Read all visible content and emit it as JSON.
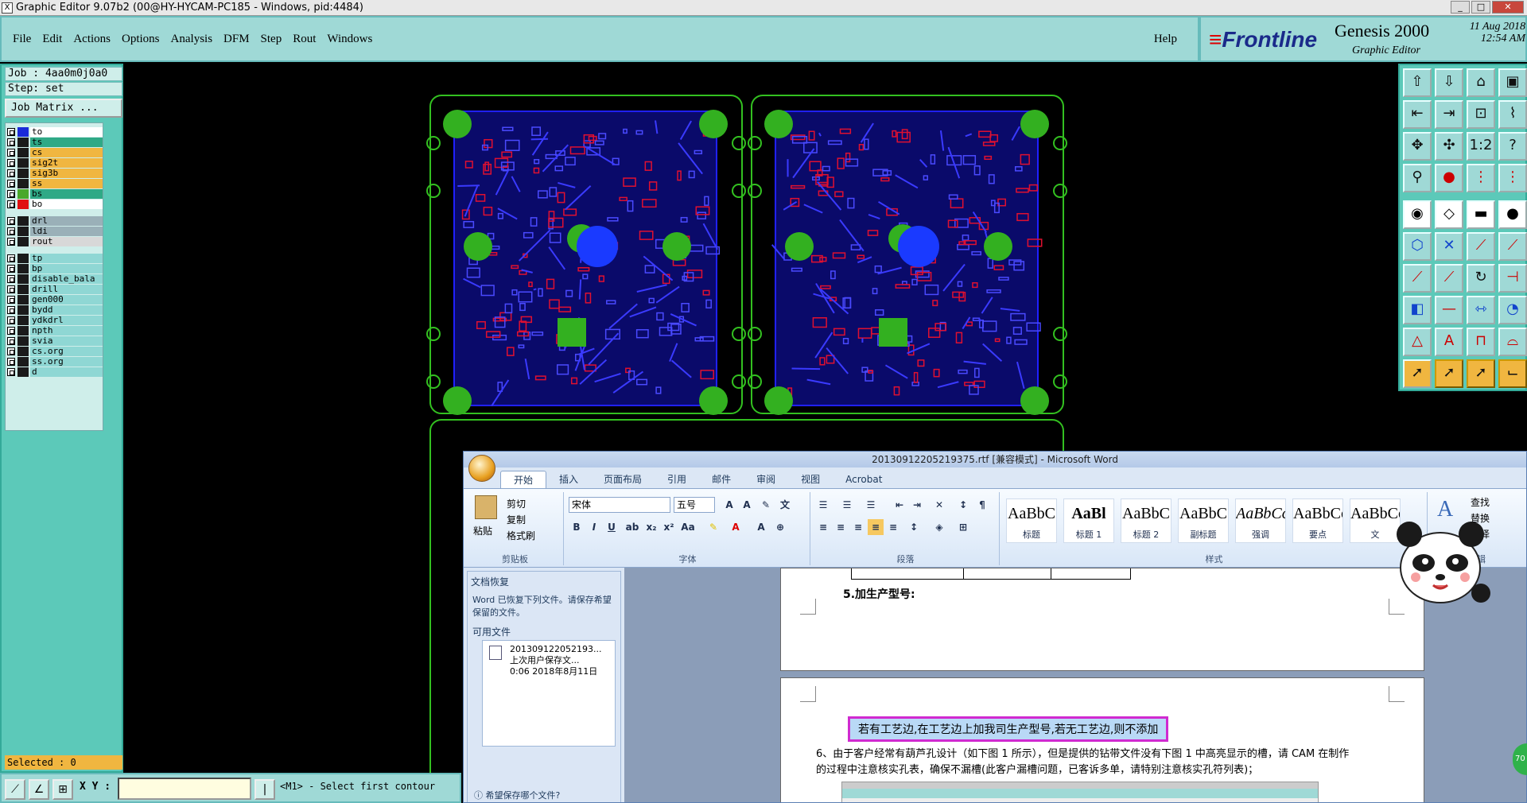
{
  "window": {
    "title": "Graphic Editor 9.07b2 (00@HY-HYCAM-PC185 - Windows, pid:4484)",
    "icon": "x-icon"
  },
  "menu": {
    "items": [
      "File",
      "Edit",
      "Actions",
      "Options",
      "Analysis",
      "DFM",
      "Step",
      "Rout",
      "Windows"
    ],
    "help": "Help"
  },
  "logo": {
    "brand": "Frontline",
    "product": "Genesis 2000",
    "subtitle": "Graphic Editor",
    "date": "11 Aug 2018",
    "time": "12:54 AM"
  },
  "job": {
    "job_line": "Job : 4aa0m0j0a0",
    "step_line": "Step: set",
    "matrix_button": "Job Matrix ..."
  },
  "layers": [
    {
      "name": "to",
      "color": "#1a2ad8",
      "bg": "#ffffff"
    },
    {
      "name": "ts",
      "color": "#1a1a1a",
      "bg": "#2fa986"
    },
    {
      "name": "cs",
      "color": "#1a1a1a",
      "bg": "#f0b640"
    },
    {
      "name": "sig2t",
      "color": "#1a1a1a",
      "bg": "#f0b640"
    },
    {
      "name": "sig3b",
      "color": "#1a1a1a",
      "bg": "#f0b640"
    },
    {
      "name": "ss",
      "color": "#1a1a1a",
      "bg": "#f0b640"
    },
    {
      "name": "bs",
      "color": "#4aa82a",
      "bg": "#2fa986"
    },
    {
      "name": "bo",
      "color": "#e01010",
      "bg": "#ffffff"
    },
    {
      "name": "drl",
      "color": "#1a1a1a",
      "bg": "#9ab0b8"
    },
    {
      "name": "ldi",
      "color": "#1a1a1a",
      "bg": "#9ab0b8"
    },
    {
      "name": "rout",
      "color": "#1a1a1a",
      "bg": "#d8d8d8"
    },
    {
      "name": "tp",
      "color": "#1a1a1a",
      "bg": "#8fd7d4"
    },
    {
      "name": "bp",
      "color": "#1a1a1a",
      "bg": "#8fd7d4"
    },
    {
      "name": "disable_bala",
      "color": "#1a1a1a",
      "bg": "#8fd7d4"
    },
    {
      "name": "drill",
      "color": "#1a1a1a",
      "bg": "#8fd7d4"
    },
    {
      "name": "gen000",
      "color": "#1a1a1a",
      "bg": "#8fd7d4"
    },
    {
      "name": "bydd",
      "color": "#1a1a1a",
      "bg": "#8fd7d4"
    },
    {
      "name": "ydkdrl",
      "color": "#1a1a1a",
      "bg": "#8fd7d4"
    },
    {
      "name": "npth",
      "color": "#1a1a1a",
      "bg": "#8fd7d4"
    },
    {
      "name": "svia",
      "color": "#1a1a1a",
      "bg": "#8fd7d4"
    },
    {
      "name": "cs.org",
      "color": "#1a1a1a",
      "bg": "#8fd7d4"
    },
    {
      "name": "ss.org",
      "color": "#1a1a1a",
      "bg": "#8fd7d4"
    },
    {
      "name": "d",
      "color": "#1a1a1a",
      "bg": "#8fd7d4"
    }
  ],
  "status": {
    "selected": "Selected : 0",
    "xy_label": "X Y :",
    "prompt": "<M1> - Select first contour"
  },
  "word": {
    "title": "20130912205219375.rtf [兼容模式] - Microsoft Word",
    "tabs": [
      "开始",
      "插入",
      "页面布局",
      "引用",
      "邮件",
      "审阅",
      "视图",
      "Acrobat"
    ],
    "clipboard": {
      "paste": "粘贴",
      "cut": "剪切",
      "copy": "复制",
      "format": "格式刷",
      "group": "剪贴板"
    },
    "font": {
      "name": "宋体",
      "size": "五号",
      "group": "字体"
    },
    "paragraph_group": "段落",
    "styles_group": "样式",
    "styles": [
      {
        "preview": "AaBbC",
        "label": "标题"
      },
      {
        "preview": "AaBl",
        "label": "标题 1"
      },
      {
        "preview": "AaBbC",
        "label": "标题 2"
      },
      {
        "preview": "AaBbC",
        "label": "副标题"
      },
      {
        "preview": "AaBbCcD",
        "label": "强调"
      },
      {
        "preview": "AaBbCcD",
        "label": "要点"
      },
      {
        "preview": "AaBbCcD",
        "label": "文"
      }
    ],
    "editing": {
      "find": "查找",
      "replace": "替换",
      "select": "选择",
      "group": "编辑"
    },
    "recovery": {
      "title": "文档恢复",
      "desc": "Word 已恢复下列文件。请保存希望保留的文件。",
      "available": "可用文件",
      "file_name": "201309122052193...",
      "file_note": "上次用户保存文...",
      "file_time": "0:06 2018年8月11日",
      "link": "希望保存哪个文件?"
    },
    "doc": {
      "heading": "5.加生产型号:",
      "highlight": "若有工艺边,在工艺边上加我司生产型号,若无工艺边,则不添加",
      "para1": "6、由于客户经常有葫芦孔设计（如下图 1 所示），但是提供的钻带文件没有下图 1 中高亮显示的槽，请 CAM 在制作",
      "para2": "的过程中注意核实孔表，确保不漏槽(此客户漏槽问题，已客诉多单，请特别注意核实孔符列表)；"
    }
  },
  "badge": "70"
}
